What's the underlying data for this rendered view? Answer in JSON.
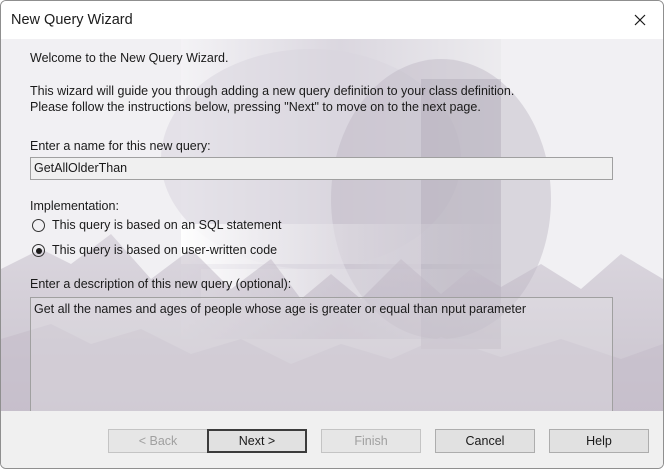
{
  "window": {
    "title": "New Query Wizard"
  },
  "intro": {
    "welcome": "Welcome to the New Query Wizard.",
    "line1": "This wizard will guide you through adding a new query definition to your class definition.",
    "line2": "Please follow the instructions below, pressing \"Next\" to move on to the next page."
  },
  "name_field": {
    "label": "Enter a name for this new query:",
    "value": "GetAllOlderThan"
  },
  "implementation": {
    "label": "Implementation:",
    "options": [
      {
        "label": "This query is based on an SQL statement",
        "selected": false
      },
      {
        "label": "This query is based on user-written code",
        "selected": true
      }
    ]
  },
  "description": {
    "label": "Enter a description of this new query (optional):",
    "value": "Get all the names and ages of people whose age is greater or equal than nput parameter"
  },
  "buttons": {
    "back": "< Back",
    "next": "Next >",
    "finish": "Finish",
    "cancel": "Cancel",
    "help": "Help"
  }
}
